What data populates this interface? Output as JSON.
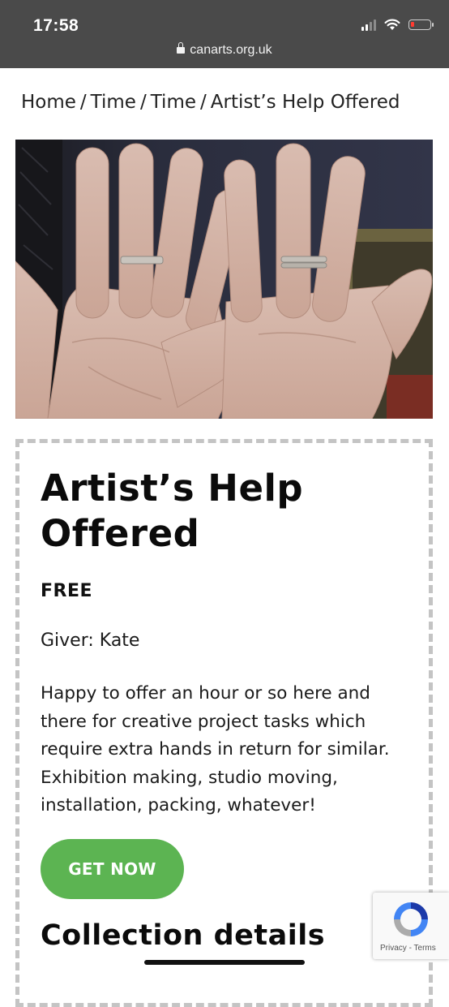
{
  "status_bar": {
    "time": "17:58",
    "signal_bars": 2,
    "battery_level": 0.1
  },
  "browser": {
    "url": "canarts.org.uk"
  },
  "breadcrumb": [
    {
      "label": "Home"
    },
    {
      "label": "Time"
    },
    {
      "label": "Time"
    },
    {
      "label": "Artist’s Help Offered"
    }
  ],
  "breadcrumb_separator": "/",
  "listing": {
    "title": "Artist’s Help Offered",
    "price": "FREE",
    "giver": "Giver: Kate",
    "description": "Happy to offer an hour or so here and there for creative project tasks which require extra hands in return for similar. Exhibition making, studio moving, installation, packing, whatever!",
    "cta_label": "GET NOW",
    "section_heading": "Collection details"
  },
  "recaptcha": {
    "privacy": "Privacy",
    "separator": " - ",
    "terms": "Terms"
  },
  "colors": {
    "cta": "#5cb452",
    "url_bar": "#4a4a4a",
    "card_border": "#c4c4c4"
  },
  "icons": [
    "lock-icon",
    "signal-icon",
    "wifi-icon",
    "battery-icon",
    "recaptcha-icon"
  ]
}
